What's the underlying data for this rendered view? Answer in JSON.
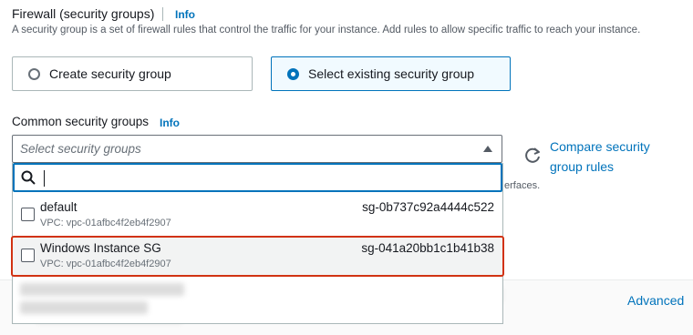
{
  "firewall": {
    "title": "Firewall (security groups)",
    "info": "Info",
    "description": "A security group is a set of firewall rules that control the traffic for your instance. Add rules to allow specific traffic to reach your instance."
  },
  "options": {
    "create": "Create security group",
    "select_existing": "Select existing security group",
    "selected": "select_existing"
  },
  "common_sg": {
    "label": "Common security groups",
    "info": "Info",
    "placeholder": "Select security groups",
    "search_value": "",
    "items": [
      {
        "name": "default",
        "vpc": "VPC: vpc-01afbc4f2eb4f2907",
        "id": "sg-0b737c92a4444c522",
        "checked": false
      },
      {
        "name": "Windows Instance SG",
        "vpc": "VPC: vpc-01afbc4f2eb4f2907",
        "id": "sg-041a20bb1c1b41b38",
        "checked": false
      }
    ]
  },
  "compare_link": "Compare security group rules",
  "partial_hidden_text": "erfaces.",
  "advanced_link": "Advanced",
  "colors": {
    "accent": "#0073bb",
    "highlight": "#d13212",
    "text": "#16191f",
    "muted": "#687078"
  }
}
